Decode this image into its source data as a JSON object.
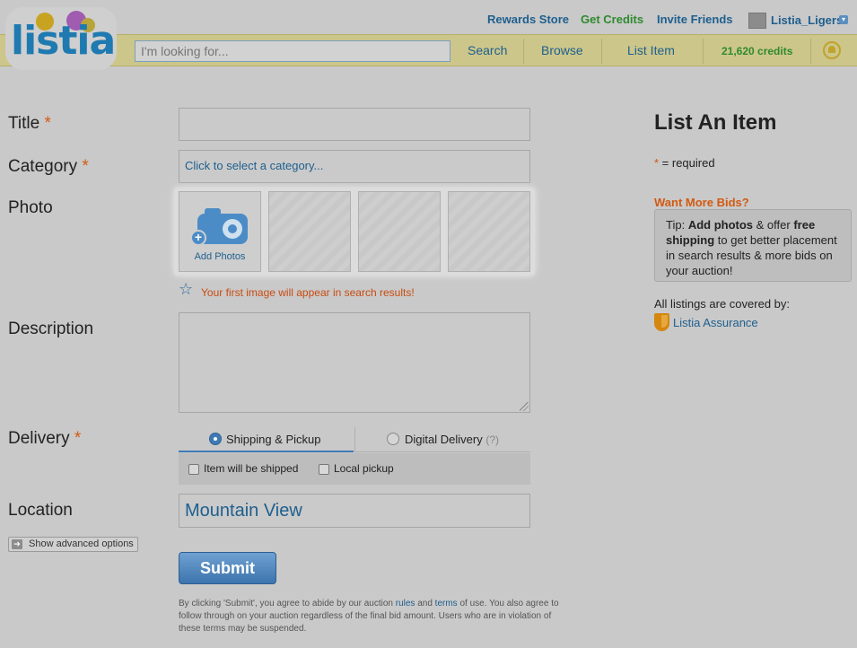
{
  "header": {
    "top_links": {
      "rewards": "Rewards Store",
      "get_credits": "Get Credits",
      "invite": "Invite Friends",
      "username": "Listia_Ligers"
    },
    "logo_text": "listia",
    "search": {
      "placeholder": "I'm looking for...",
      "value": ""
    },
    "nav": {
      "search": "Search",
      "browse": "Browse",
      "list_item": "List Item",
      "credits": "21,620 credits"
    }
  },
  "form": {
    "title_label": "Title",
    "category_label": "Category",
    "category_placeholder": "Click to select a category...",
    "photo_label": "Photo",
    "add_photos": "Add Photos",
    "photo_note": "Your first image will appear in search results!",
    "description_label": "Description",
    "delivery_label": "Delivery",
    "delivery_tabs": {
      "shipping": "Shipping & Pickup",
      "digital": "Digital Delivery",
      "digital_help": "(?)",
      "shipping_selected": true
    },
    "shipping_options": {
      "shipped": "Item will be shipped",
      "pickup": "Local pickup"
    },
    "location_label": "Location",
    "location_value": "Mountain View",
    "advanced_options": "Show advanced options",
    "submit": "Submit",
    "required_mark": "*",
    "terms": {
      "part1": "By clicking 'Submit', you agree to abide by our auction ",
      "rules_link": "rules",
      "and": " and ",
      "terms_link": "terms",
      "part2": " of use. You also agree to follow through on your auction regardless of the final bid amount. Users who are in violation of these terms may be suspended."
    }
  },
  "sidebar": {
    "title": "List An Item",
    "required_star": "*",
    "required_text": " = required",
    "more_bids": "Want More Bids?",
    "tip": {
      "prefix": "Tip: ",
      "bold1": "Add photos",
      "mid": " & offer ",
      "bold2": "free shipping",
      "suffix": " to get better placement in search results & more bids on your auction!"
    },
    "covered": "All listings are covered by:",
    "assurance": "Listia Assurance"
  },
  "colors": {
    "background": "#c9c9c9",
    "nav_bar": "#ccc68a",
    "link_blue": "#1e5f8e",
    "green": "#2f8a2f",
    "required_orange": "#d25a12",
    "submit_blue": "#3d74ad"
  },
  "icons": [
    "user-avatar-icon",
    "dropdown-caret-icon",
    "notification-bell-icon",
    "camera-add-icon",
    "star-icon",
    "resize-handle-icon",
    "arrow-right-icon",
    "shield-icon"
  ]
}
